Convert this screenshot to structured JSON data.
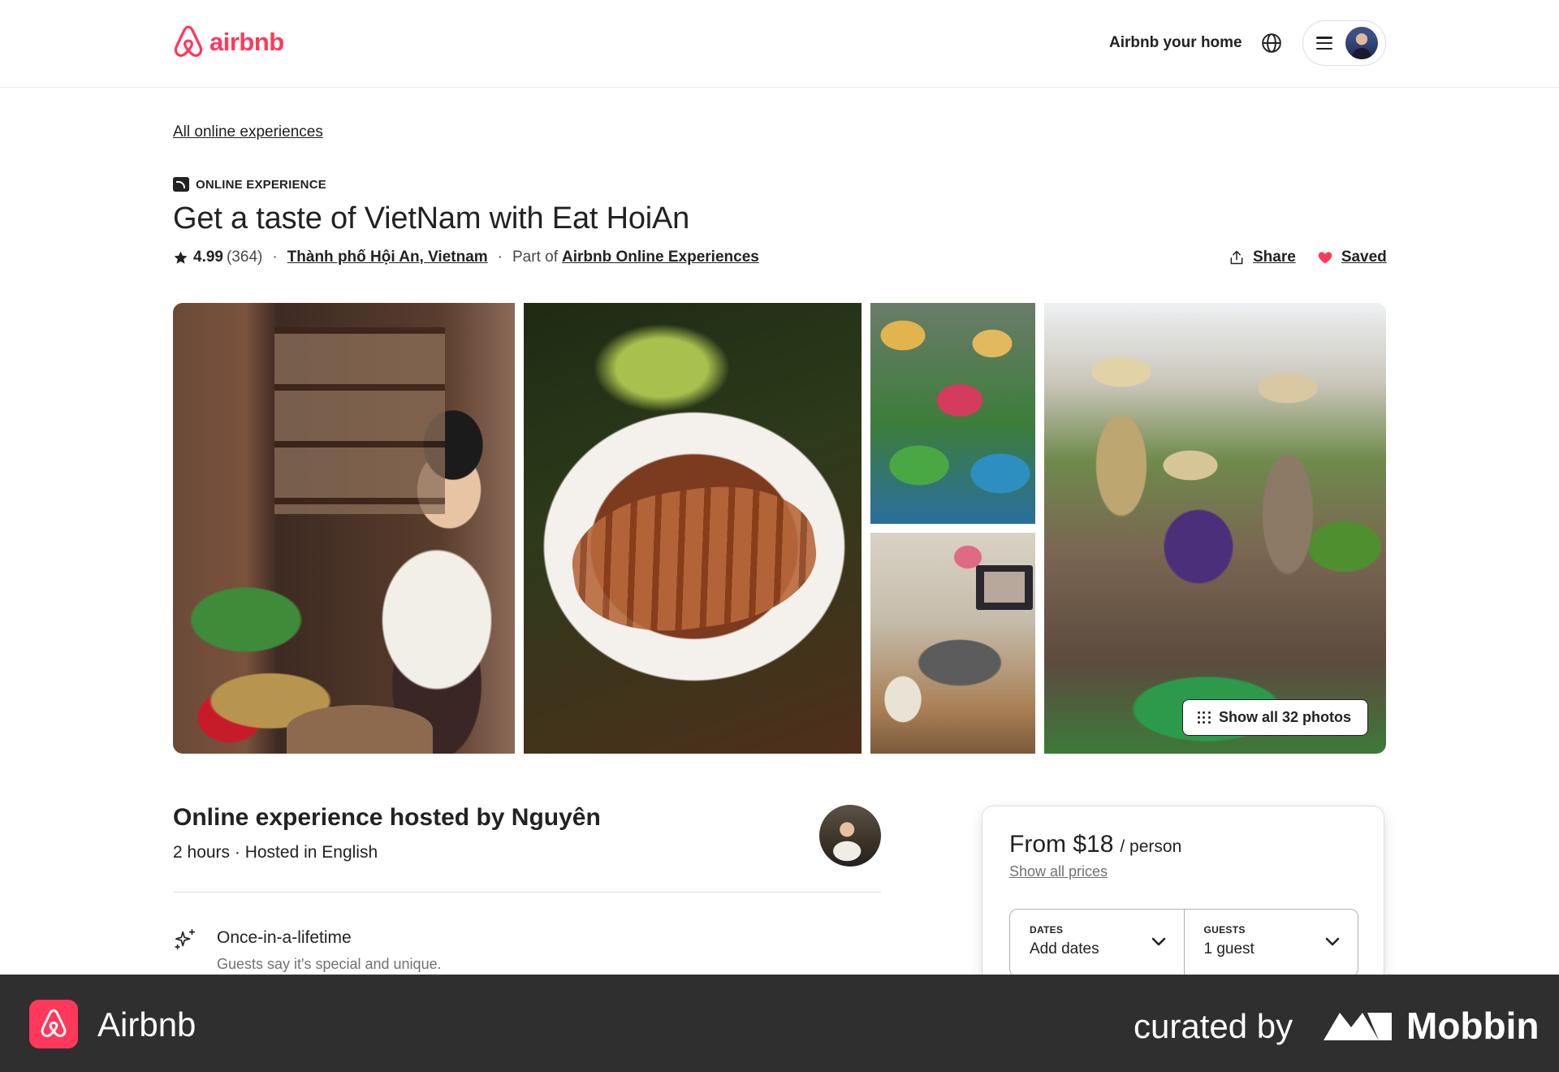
{
  "header": {
    "brand": "airbnb",
    "host_link": "Airbnb your home",
    "globe_icon": "globe-icon",
    "menu_icon": "hamburger-icon",
    "brand_color": "#ff385c"
  },
  "breadcrumb": "All online experiences",
  "listing": {
    "category": "ONLINE EXPERIENCE",
    "title": "Get a taste of VietNam with Eat HoiAn",
    "rating": "4.99",
    "reviews": "(364)",
    "location": "Thành phố Hội An, Vietnam",
    "part_of_prefix": "Part of",
    "part_of_link": "Airbnb Online Experiences",
    "share_label": "Share",
    "saved_label": "Saved",
    "separator": "·"
  },
  "gallery": {
    "show_all_label": "Show all 32 photos"
  },
  "host": {
    "title": "Online experience hosted by Nguyên",
    "subtitle": "2 hours · Hosted in English"
  },
  "feature": {
    "title": "Once-in-a-lifetime",
    "subtitle": "Guests say it's special and unique."
  },
  "booking": {
    "price": "From $18",
    "per": "/ person",
    "show_prices": "Show all prices",
    "dates_label": "DATES",
    "dates_value": "Add dates",
    "guests_label": "GUESTS",
    "guests_value": "1 guest"
  },
  "footer": {
    "app_name": "Airbnb",
    "curated_by": "curated by",
    "mobbin": "Mobbin"
  }
}
